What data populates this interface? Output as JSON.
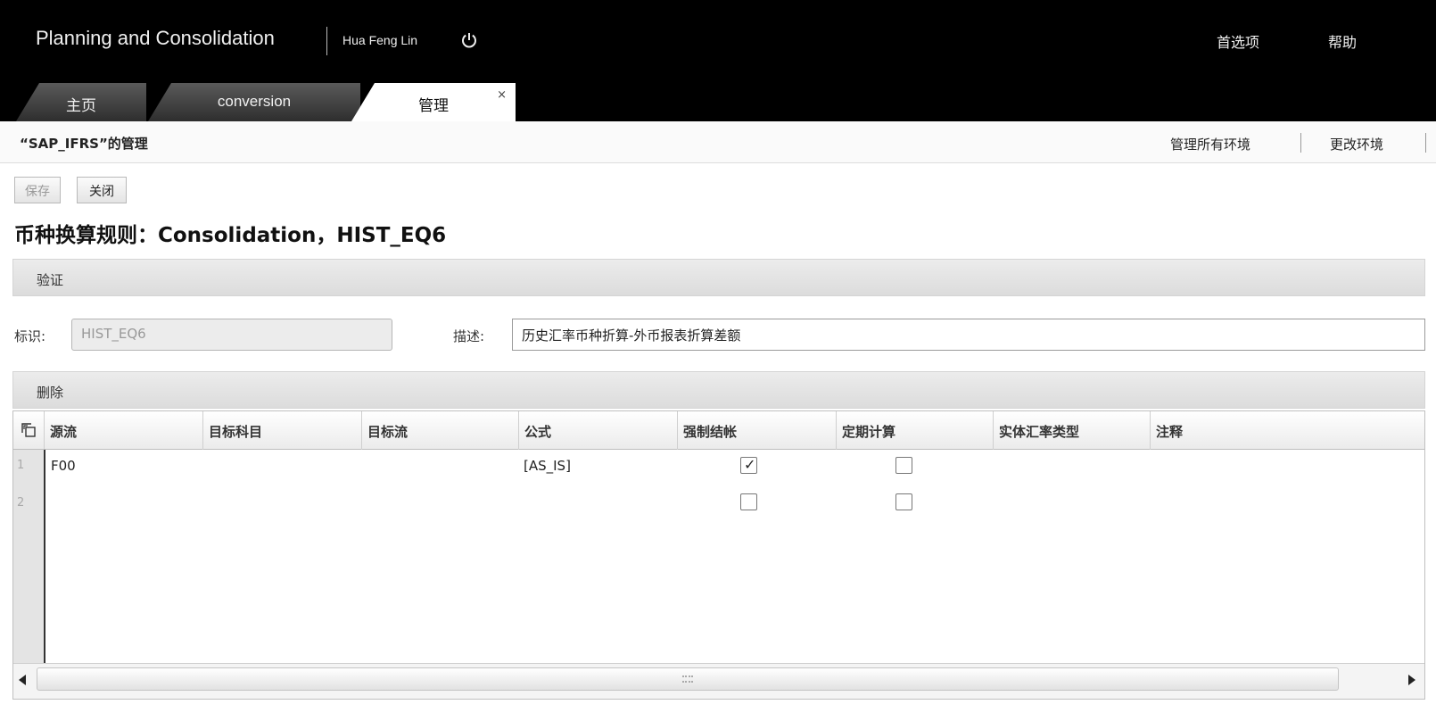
{
  "header": {
    "app_title": "Planning and Consolidation",
    "user_name": "Hua Feng Lin",
    "preferences_label": "首选项",
    "help_label": "帮助"
  },
  "tabs": [
    {
      "label": "主页",
      "active": false
    },
    {
      "label": "conversion",
      "active": false
    },
    {
      "label": "管理",
      "active": true,
      "close": "×"
    }
  ],
  "subheader": {
    "title": "“SAP_IFRS”的管理",
    "manage_all_env_label": "管理所有环境",
    "change_env_label": "更改环境"
  },
  "toolbar": {
    "save_label": "保存",
    "close_label": "关闭"
  },
  "page": {
    "heading": "币种换算规则：Consolidation，HIST_EQ6"
  },
  "validate_section": {
    "label": "验证",
    "id_label": "标识:",
    "id_value": "HIST_EQ6",
    "desc_label": "描述:",
    "desc_value": "历史汇率币种折算-外币报表折算差额"
  },
  "delete_section": {
    "label": "删除"
  },
  "table": {
    "columns": [
      "源流",
      "目标科目",
      "目标流",
      "公式",
      "强制结帐",
      "定期计算",
      "实体汇率类型",
      "注释"
    ],
    "rows": [
      {
        "num": "1",
        "source_flow": "F00",
        "target_account": "",
        "target_flow": "",
        "formula": "[AS_IS]",
        "force_close": true,
        "periodic": false,
        "entity_rate_type": "",
        "comment": ""
      },
      {
        "num": "2",
        "source_flow": "",
        "target_account": "",
        "target_flow": "",
        "formula": "",
        "force_close": false,
        "periodic": false,
        "entity_rate_type": "",
        "comment": ""
      }
    ]
  },
  "icons": {
    "power": "power-icon",
    "corner": "column-chooser-icon",
    "scroll_left": "scroll-left-arrow-icon",
    "scroll_right": "scroll-right-arrow-icon"
  }
}
